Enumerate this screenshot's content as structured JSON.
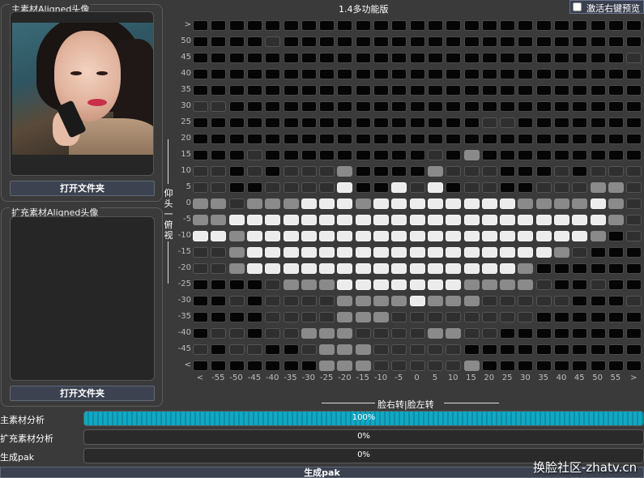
{
  "main_panel": {
    "title": "主素材Aligned头像",
    "open_button": "打开文件夹"
  },
  "ext_panel": {
    "title": "扩充素材Aligned头像",
    "open_button": "打开文件夹"
  },
  "version": "1.4多功能版",
  "right_click_preview": {
    "label": "激活右键预览",
    "checked": false
  },
  "grid": {
    "y_labels": [
      ">",
      "50",
      "45",
      "40",
      "35",
      "30",
      "25",
      "20",
      "15",
      "10",
      "5",
      "0",
      "-5",
      "-10",
      "-15",
      "-20",
      "-25",
      "-30",
      "-35",
      "-40",
      "-45",
      "<"
    ],
    "x_labels": [
      "<",
      "-55",
      "-50",
      "-45",
      "-40",
      "-35",
      "-30",
      "-25",
      "-20",
      "-15",
      "-10",
      "-5",
      "0",
      "5",
      "10",
      "15",
      "20",
      "25",
      "30",
      "35",
      "40",
      "45",
      "50",
      "55",
      ">"
    ],
    "vertical_axis_label": "仰头|俯视",
    "horizontal_axis_label": "脸右转|脸左转",
    "levels": [
      "0000000000000000000000000",
      "0000100000000000000000000",
      "0000000000000000000000001",
      "0000000000000000000000000",
      "0000000000000000000000000",
      "1100000000000000000000000",
      "0000000000000000110000000",
      "0000000000000000000000000",
      "0001000000000102000000000",
      "1101011120000211100010111",
      "1100111130031301100111221",
      "2212223332333333332222321",
      "2233333333333333333333321",
      "3323333333333333333333201",
      "1123333333333333333321000",
      "1123333333333333332000000",
      "0000122233333332222100100",
      "0010111122223222111110001",
      "0000111122211111111000000",
      "0110112221111221100000000",
      "1011001222111110000000000",
      "0000000222111112000000000"
    ]
  },
  "progress": [
    {
      "label": "主素材分析",
      "value": 100,
      "text": "100%"
    },
    {
      "label": "扩充素材分析",
      "value": 0,
      "text": "0%"
    },
    {
      "label": "生成pak",
      "value": 0,
      "text": "0%"
    }
  ],
  "generate_button": "生成pak",
  "watermark": "换脸社区-zhatv.cn",
  "colors": {
    "progress_fill": "#11a8c4",
    "button_bg": "#3c4250"
  }
}
